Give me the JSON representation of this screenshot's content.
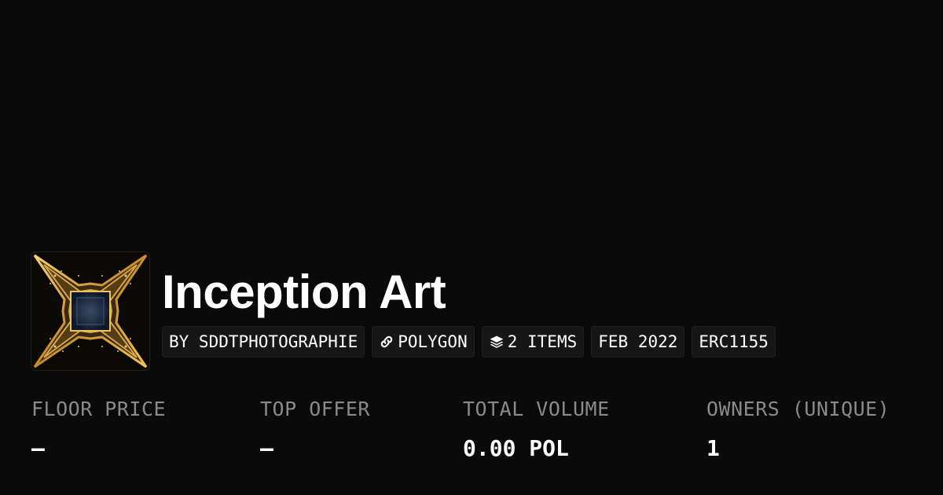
{
  "collection": {
    "title": "Inception Art",
    "creator": "BY SDDTPHOTOGRAPHIE",
    "chain": "POLYGON",
    "items": "2 ITEMS",
    "date": "FEB 2022",
    "standard": "ERC1155",
    "avatar_icon": "collection-image"
  },
  "stats": {
    "floor_price": {
      "label": "FLOOR PRICE",
      "value": "–"
    },
    "top_offer": {
      "label": "TOP OFFER",
      "value": "–"
    },
    "total_volume": {
      "label": "TOTAL VOLUME",
      "value": "0.00 POL"
    },
    "owners": {
      "label": "OWNERS (UNIQUE)",
      "value": "1"
    }
  },
  "colors": {
    "background": "#0a0a0a",
    "tag_background": "#161616",
    "label": "#8a8a8a",
    "text": "#ffffff",
    "avatar_gold": "#e8b64a"
  }
}
